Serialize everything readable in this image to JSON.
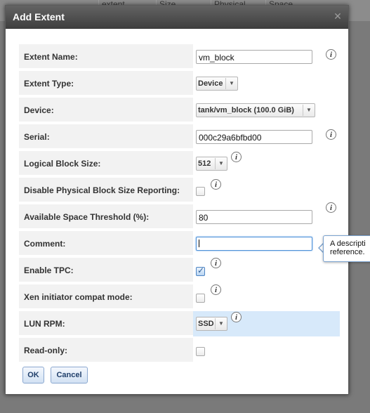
{
  "background": {
    "columns": [
      "extent",
      "Size",
      "Physical Block Size",
      "Space Threshold"
    ]
  },
  "dialog": {
    "title": "Add Extent",
    "close_icon": "close-icon"
  },
  "fields": [
    {
      "label": "Extent Name:",
      "type": "text",
      "value": "vm_block",
      "info": true
    },
    {
      "label": "Extent Type:",
      "type": "select",
      "value": "Device",
      "info": false
    },
    {
      "label": "Device:",
      "type": "select",
      "value": "tank/vm_block (100.0 GiB)",
      "info": false
    },
    {
      "label": "Serial:",
      "type": "text",
      "value": "000c29a6bfbd00",
      "info": true
    },
    {
      "label": "Logical Block Size:",
      "type": "select",
      "value": "512",
      "info": true
    },
    {
      "label": "Disable Physical Block Size Reporting:",
      "type": "checkbox",
      "checked": false,
      "info": true
    },
    {
      "label": "Available Space Threshold (%):",
      "type": "text",
      "value": "80",
      "info": true
    },
    {
      "label": "Comment:",
      "type": "text",
      "value": "",
      "focused": true,
      "info": false
    },
    {
      "label": "Enable TPC:",
      "type": "checkbox",
      "checked": true,
      "info": true
    },
    {
      "label": "Xen initiator compat mode:",
      "type": "checkbox",
      "checked": false,
      "info": true
    },
    {
      "label": "LUN RPM:",
      "type": "select",
      "value": "SSD",
      "info": true,
      "highlighted": true
    },
    {
      "label": "Read-only:",
      "type": "checkbox",
      "checked": false,
      "info": false
    }
  ],
  "tooltip": {
    "line1": "A descripti",
    "line2": "reference."
  },
  "buttons": {
    "ok": "OK",
    "cancel": "Cancel"
  },
  "colors": {
    "titlebar": "#4f4f4f",
    "label_bg": "#f2f2f2",
    "highlight": "#d7e9fa",
    "button_text": "#21406b"
  }
}
